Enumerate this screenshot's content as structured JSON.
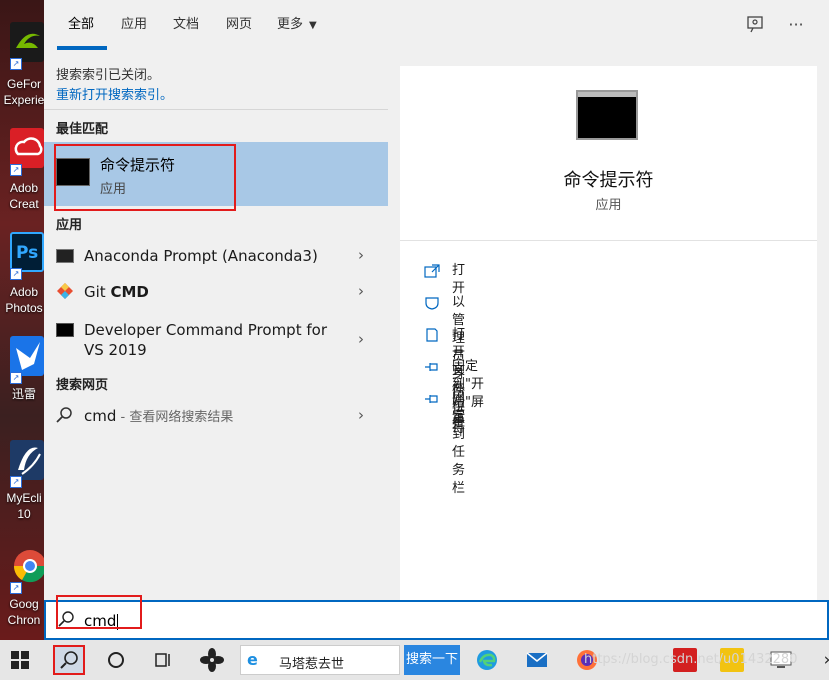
{
  "desktop": {
    "icons": [
      {
        "name": "geforce-experience",
        "label": "GeFor\nExperie",
        "color": "#1a1a1a",
        "accent": "#76b900"
      },
      {
        "name": "adobe-creative-cloud",
        "label": "Adob\nCreat",
        "color": "#da1f26",
        "accent": "#ffffff"
      },
      {
        "name": "adobe-photoshop",
        "label": "Adob\nPhotos",
        "color": "#001e36",
        "accent": "#31a8ff"
      },
      {
        "name": "xunlei",
        "label": "迅雷",
        "color": "#1a74e8",
        "accent": "#ffffff"
      },
      {
        "name": "myeclipse",
        "label": "MyEcli\n10",
        "color": "#1e3a66",
        "accent": "#ffffff"
      },
      {
        "name": "google-chrome",
        "label": "Goog\nChron",
        "color": "#dd4b39",
        "accent": "#fbbc05"
      }
    ]
  },
  "tabs": [
    {
      "label": "全部",
      "active": true
    },
    {
      "label": "应用",
      "active": false
    },
    {
      "label": "文档",
      "active": false
    },
    {
      "label": "网页",
      "active": false
    },
    {
      "label": "更多",
      "active": false
    }
  ],
  "notice": {
    "text": "搜索索引已关闭。",
    "link": "重新打开搜索索引。"
  },
  "best_match": {
    "heading": "最佳匹配",
    "title": "命令提示符",
    "subtitle": "应用"
  },
  "apps": {
    "heading": "应用",
    "items": [
      {
        "label_plain": "Anaconda Prompt (Anaconda3)",
        "label_bold": "",
        "icon": "terminal-icon"
      },
      {
        "label_plain": "Git ",
        "label_bold": "CMD",
        "icon": "git-icon"
      },
      {
        "label_plain": "Developer Command Prompt for VS 2019",
        "label_bold": "",
        "icon": "terminal-icon"
      }
    ]
  },
  "web": {
    "heading": "搜索网页",
    "query": "cmd",
    "suffix": " - 查看网络搜索结果"
  },
  "detail": {
    "title": "命令提示符",
    "subtitle": "应用",
    "actions": [
      {
        "label": "打开",
        "icon": "open-icon"
      },
      {
        "label": "以管理员身份运行",
        "icon": "shield-icon"
      },
      {
        "label": "打开文件位置",
        "icon": "file-location-icon"
      },
      {
        "label": "固定到\"开始\"屏幕",
        "icon": "pin-icon"
      },
      {
        "label": "固定到任务栏",
        "icon": "pin-icon"
      }
    ]
  },
  "search": {
    "value": "cmd"
  },
  "taskbar": {
    "news_text": "马塔惹去世",
    "news_button": "搜索一下",
    "watermark": "https://blog.csdn.net/u01432280"
  },
  "colors": {
    "accent": "#0067c0",
    "highlight": "#a8c8e6",
    "annotation": "#e21b1b"
  }
}
